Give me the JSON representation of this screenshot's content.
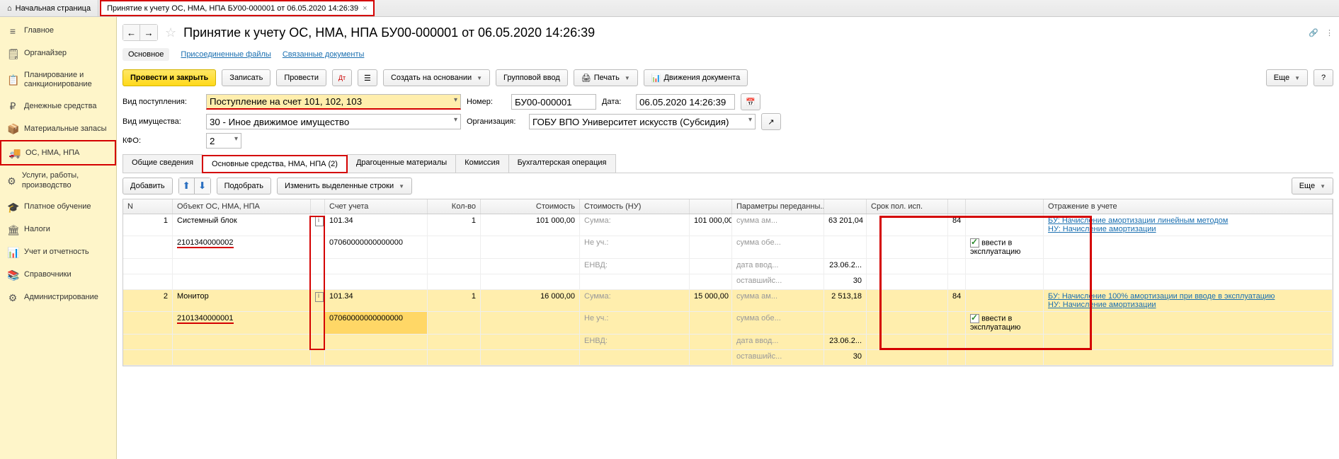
{
  "tabs": {
    "home": "Начальная страница",
    "doc": "Принятие к учету ОС, НМА, НПА БУ00-000001 от 06.05.2020 14:26:39"
  },
  "nav": [
    {
      "icon": "≡",
      "label": "Главное"
    },
    {
      "icon": "🗒",
      "label": "Органайзер"
    },
    {
      "icon": "📋",
      "label": "Планирование и санкционирование"
    },
    {
      "icon": "₽",
      "label": "Денежные средства"
    },
    {
      "icon": "📦",
      "label": "Материальные запасы"
    },
    {
      "icon": "🚚",
      "label": "ОС, НМА, НПА"
    },
    {
      "icon": "⚙",
      "label": "Услуги, работы, производство"
    },
    {
      "icon": "🎓",
      "label": "Платное обучение"
    },
    {
      "icon": "🏛",
      "label": "Налоги"
    },
    {
      "icon": "📊",
      "label": "Учет и отчетность"
    },
    {
      "icon": "📚",
      "label": "Справочники"
    },
    {
      "icon": "⚙",
      "label": "Администрирование"
    }
  ],
  "title": "Принятие к учету ОС, НМА, НПА БУ00-000001 от 06.05.2020 14:26:39",
  "subnav": {
    "main": "Основное",
    "files": "Присоединенные файлы",
    "linked": "Связанные документы"
  },
  "toolbar": {
    "post_close": "Провести и закрыть",
    "write": "Записать",
    "post": "Провести",
    "create_from": "Создать на основании",
    "group": "Групповой ввод",
    "print": "Печать",
    "moves": "Движения документа",
    "more": "Еще"
  },
  "form": {
    "receipt_lbl": "Вид поступления:",
    "receipt_val": "Поступление на счет 101, 102, 103",
    "number_lbl": "Номер:",
    "number_val": "БУ00-000001",
    "date_lbl": "Дата:",
    "date_val": "06.05.2020 14:26:39",
    "prop_lbl": "Вид имущества:",
    "prop_val": "30 - Иное движимое имущество",
    "org_lbl": "Организация:",
    "org_val": "ГОБУ ВПО Университет искусств (Субсидия)",
    "kfo_lbl": "КФО:",
    "kfo_val": "2"
  },
  "itabs": {
    "general": "Общие сведения",
    "os": "Основные средства, НМА, НПА (2)",
    "precious": "Драгоценные материалы",
    "commission": "Комиссия",
    "bookop": "Бухгалтерская операция"
  },
  "tabbar2": {
    "add": "Добавить",
    "pick": "Подобрать",
    "edit": "Изменить выделенные строки",
    "more": "Еще"
  },
  "gridhead": {
    "n": "N",
    "obj": "Объект ОС, НМА, НПА",
    "acct": "Счет учета",
    "qty": "Кол-во",
    "cost": "Стоимость",
    "costnu": "Стоимость (НУ)",
    "params": "Параметры переданны...",
    "srok": "Срок пол. исп.",
    "refl": "Отражение в учете"
  },
  "rows": [
    {
      "n": "1",
      "name": "Системный блок",
      "inv": "2101340000002",
      "acct": "101.34",
      "analyt": "07060000000000000",
      "qty": "1",
      "cost": "101 000,00",
      "nu": [
        [
          "Сумма:",
          "101 000,00"
        ],
        [
          "Не уч.:",
          ""
        ],
        [
          "ЕНВД:",
          ""
        ]
      ],
      "params": [
        [
          "сумма ам...",
          "63 201,04"
        ],
        [
          "сумма обе...",
          ""
        ],
        [
          "дата ввод...",
          "23.06.2..."
        ],
        [
          "оставшийс...",
          "30"
        ]
      ],
      "srok": "84",
      "in_service": "ввести в эксплуатацию",
      "refl": [
        "БУ: Начисление амортизации линейным методом",
        "НУ: Начисление амортизации"
      ]
    },
    {
      "n": "2",
      "name": "Монитор",
      "inv": "2101340000001",
      "acct": "101.34",
      "analyt": "07060000000000000",
      "qty": "1",
      "cost": "16 000,00",
      "nu": [
        [
          "Сумма:",
          "15 000,00"
        ],
        [
          "Не уч.:",
          ""
        ],
        [
          "ЕНВД:",
          ""
        ]
      ],
      "params": [
        [
          "сумма ам...",
          "2 513,18"
        ],
        [
          "сумма обе...",
          ""
        ],
        [
          "дата ввод...",
          "23.06.2..."
        ],
        [
          "оставшийс...",
          "30"
        ]
      ],
      "srok": "84",
      "in_service": "ввести в эксплуатацию",
      "refl": [
        "БУ: Начисление 100% амортизации при вводе в эксплуатацию",
        "НУ: Начисление амортизации"
      ]
    }
  ]
}
